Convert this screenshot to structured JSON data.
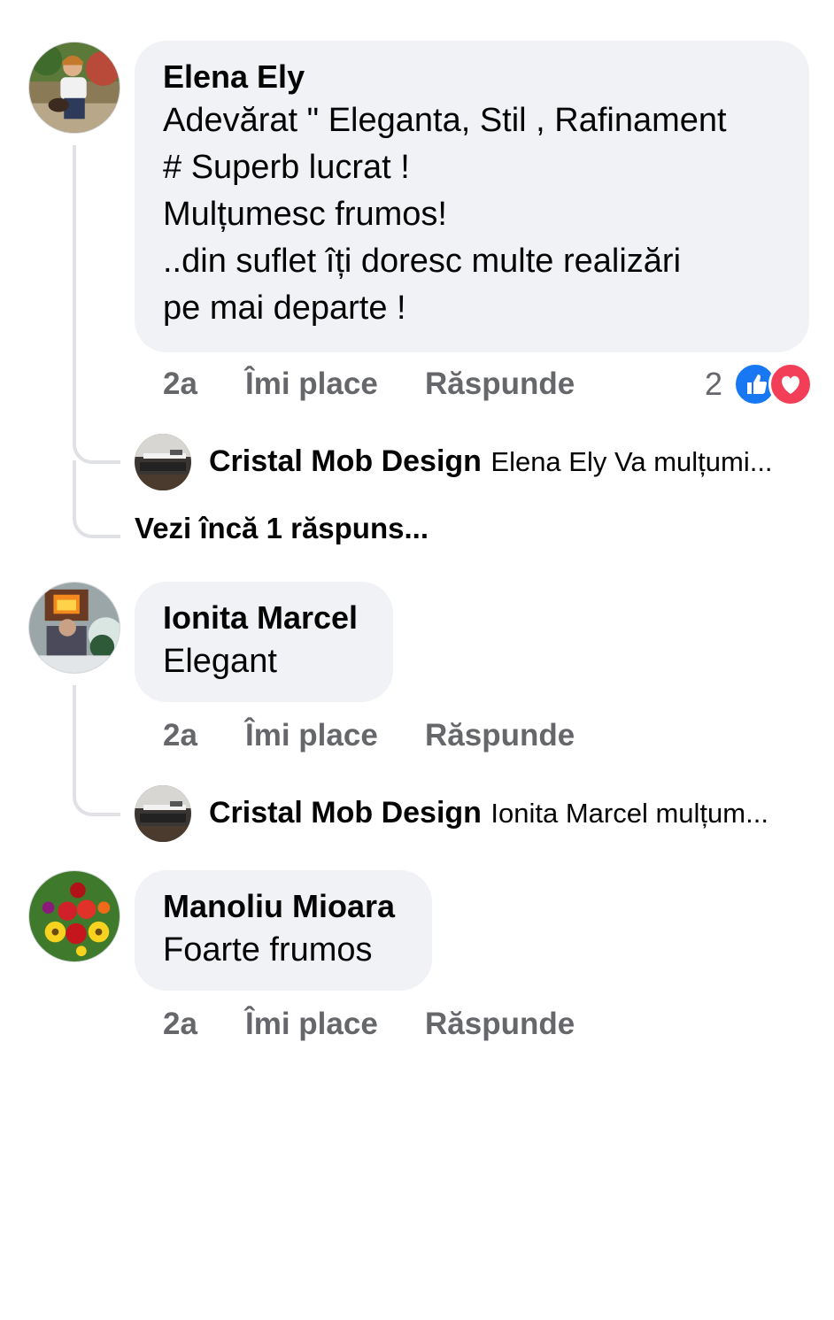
{
  "comments": [
    {
      "author": "Elena Ely",
      "text_lines": [
        "Adevărat \" Eleganta, Stil , Rafinament",
        "#  Superb lucrat !",
        "Mulțumesc frumos!",
        "..din suflet îți doresc multe realizări",
        "pe mai departe !"
      ],
      "time": "2a",
      "like_label": "Îmi place",
      "reply_label": "Răspunde",
      "reaction_count": "2",
      "reaction_icons": [
        "like-icon",
        "love-icon"
      ],
      "reply": {
        "author": "Cristal Mob Design",
        "preview": "Elena Ely Va mulțumi..."
      },
      "more_replies": "Vezi încă 1 răspuns..."
    },
    {
      "author": "Ionita Marcel",
      "text_lines": [
        "Elegant"
      ],
      "time": "2a",
      "like_label": "Îmi place",
      "reply_label": "Răspunde",
      "reply": {
        "author": "Cristal Mob Design",
        "preview": "Ionita Marcel mulțum..."
      }
    },
    {
      "author": "Manoliu Mioara",
      "text_lines": [
        "Foarte frumos"
      ],
      "time": "2a",
      "like_label": "Îmi place",
      "reply_label": "Răspunde"
    }
  ],
  "colors": {
    "bubble": "#f0f2f5",
    "meta_text": "#65676b",
    "like_blue": "#1877f2",
    "love_red": "#f33e58"
  }
}
